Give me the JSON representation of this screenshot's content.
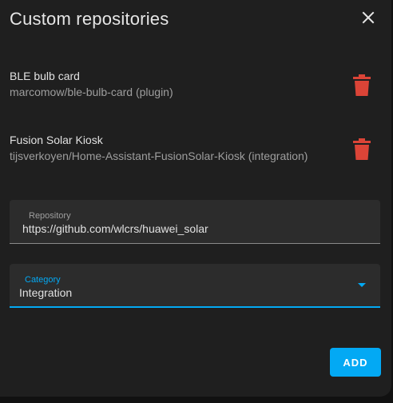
{
  "dialog": {
    "title": "Custom repositories"
  },
  "repositories": [
    {
      "name": "BLE bulb card",
      "subtitle": "marcomow/ble-bulb-card (plugin)"
    },
    {
      "name": "Fusion Solar Kiosk",
      "subtitle": "tijsverkoyen/Home-Assistant-FusionSolar-Kiosk (integration)"
    }
  ],
  "form": {
    "repository": {
      "label": "Repository",
      "value": "https://github.com/wlcrs/huawei_solar"
    },
    "category": {
      "label": "Category",
      "value": "Integration"
    }
  },
  "actions": {
    "add_label": "ADD"
  },
  "colors": {
    "accent": "#03a9f4",
    "delete": "#db4437",
    "background": "#1f1f1f"
  },
  "icons": {
    "close": "close-icon",
    "delete": "trash-icon",
    "dropdown": "chevron-down-icon"
  }
}
